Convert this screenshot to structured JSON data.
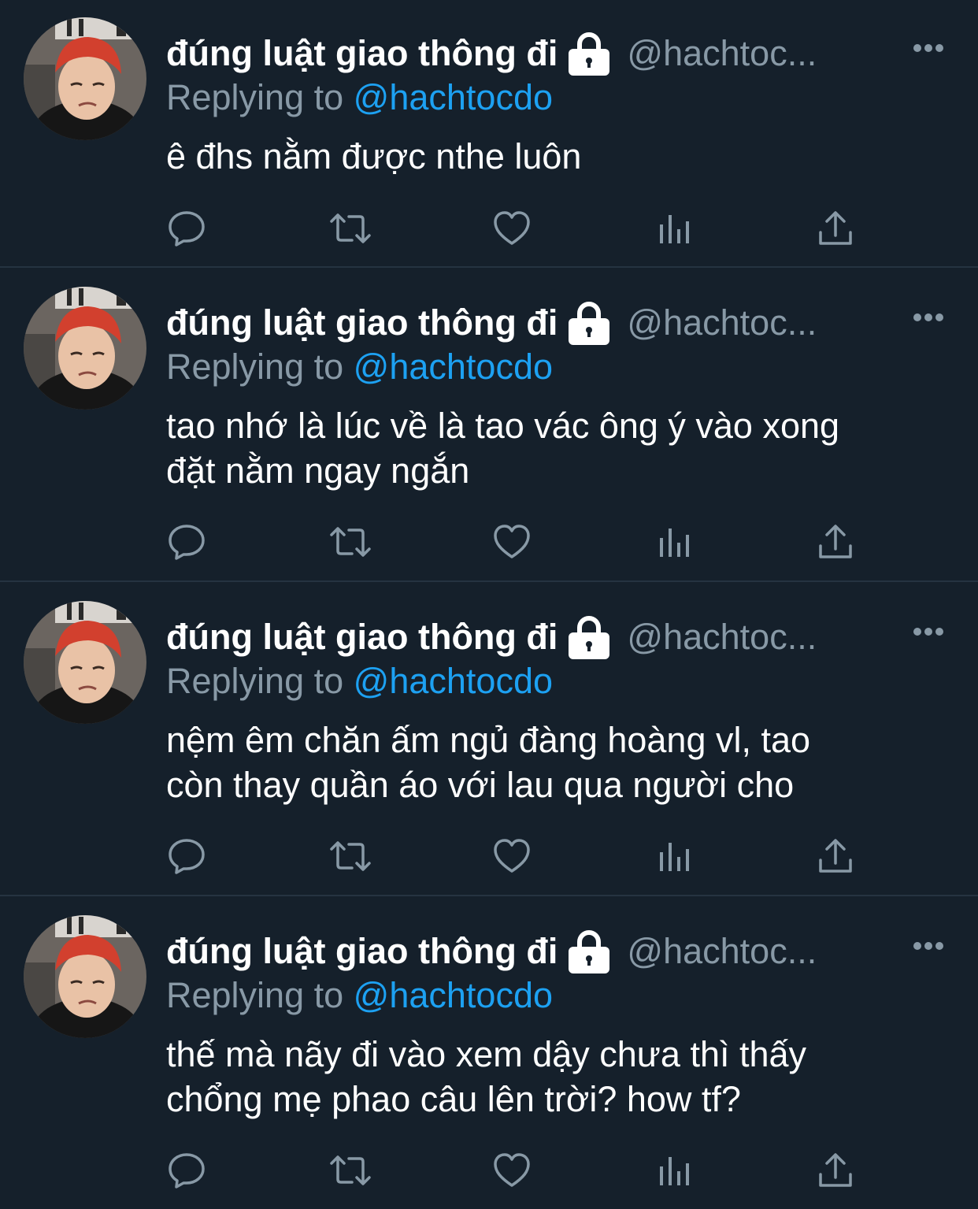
{
  "tweets": [
    {
      "display_name": "đúng luật giao thông đi",
      "handle": "@hachtoc...",
      "replying_prefix": "Replying to",
      "replying_to": "@hachtocdo",
      "text": "ê đhs nằm được nthe luôn"
    },
    {
      "display_name": "đúng luật giao thông đi",
      "handle": "@hachtoc...",
      "replying_prefix": "Replying to",
      "replying_to": "@hachtocdo",
      "text": "tao nhớ là lúc về là tao vác ông ý vào xong\nđặt nằm ngay ngắn"
    },
    {
      "display_name": "đúng luật giao thông đi",
      "handle": "@hachtoc...",
      "replying_prefix": "Replying to",
      "replying_to": "@hachtocdo",
      "text": "nệm êm chăn ấm ngủ đàng hoàng vl, tao\ncòn thay quần áo với lau qua người cho"
    },
    {
      "display_name": "đúng luật giao thông đi",
      "handle": "@hachtoc...",
      "replying_prefix": "Replying to",
      "replying_to": "@hachtocdo",
      "text": "thế mà nãy đi vào xem dậy chưa thì thấy\nchổng mẹ phao câu lên trời? how tf?"
    }
  ],
  "icons": {
    "lock": "lock-icon",
    "more": "more-options-icon",
    "reply": "reply-icon",
    "retweet": "retweet-icon",
    "like": "like-icon",
    "analytics": "analytics-icon",
    "share": "share-icon"
  },
  "colors": {
    "background": "#15202b",
    "divider": "#253341",
    "text_primary": "#ffffff",
    "text_secondary": "#8899a6",
    "mention": "#1da1f2"
  }
}
